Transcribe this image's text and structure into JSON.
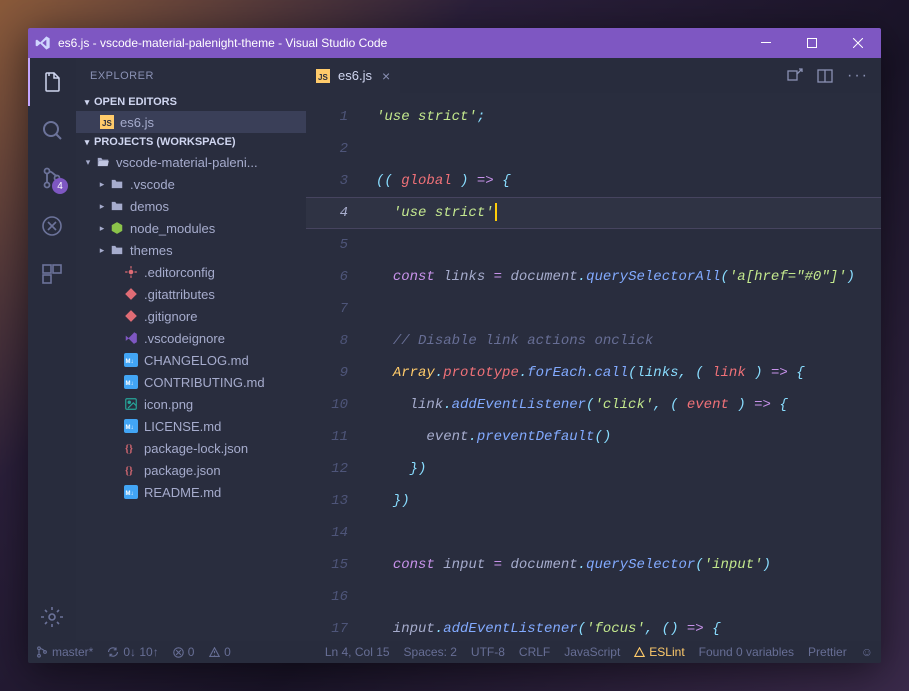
{
  "titlebar": {
    "title": "es6.js - vscode-material-palenight-theme - Visual Studio Code"
  },
  "activity": {
    "scmBadge": "4"
  },
  "sidebar": {
    "title": "EXPLORER",
    "openEditorsLabel": "OPEN EDITORS",
    "workspaceLabel": "PROJECTS (WORKSPACE)",
    "openEditors": [
      {
        "label": "es6.js",
        "icon": "js",
        "selected": true
      }
    ],
    "tree": [
      {
        "depth": 0,
        "chev": "▾",
        "icon": "folder-open",
        "label": "vscode-material-paleni...",
        "color": "#a6accd"
      },
      {
        "depth": 1,
        "chev": "▸",
        "icon": "folder",
        "label": ".vscode",
        "color": "#a6accd"
      },
      {
        "depth": 1,
        "chev": "▸",
        "icon": "folder",
        "label": "demos",
        "color": "#a6accd"
      },
      {
        "depth": 1,
        "chev": "▸",
        "icon": "node",
        "label": "node_modules",
        "color": "#8bc34a"
      },
      {
        "depth": 1,
        "chev": "▸",
        "icon": "folder",
        "label": "themes",
        "color": "#a6accd"
      },
      {
        "depth": 2,
        "chev": "",
        "icon": "config",
        "label": ".editorconfig",
        "color": "#e06c75"
      },
      {
        "depth": 2,
        "chev": "",
        "icon": "git",
        "label": ".gitattributes",
        "color": "#e06c75"
      },
      {
        "depth": 2,
        "chev": "",
        "icon": "git",
        "label": ".gitignore",
        "color": "#e06c75"
      },
      {
        "depth": 2,
        "chev": "",
        "icon": "vscode",
        "label": ".vscodeignore",
        "color": "#7e57c2"
      },
      {
        "depth": 2,
        "chev": "",
        "icon": "md",
        "label": "CHANGELOG.md",
        "color": "#42a5f5"
      },
      {
        "depth": 2,
        "chev": "",
        "icon": "md",
        "label": "CONTRIBUTING.md",
        "color": "#42a5f5"
      },
      {
        "depth": 2,
        "chev": "",
        "icon": "image",
        "label": "icon.png",
        "color": "#26a69a"
      },
      {
        "depth": 2,
        "chev": "",
        "icon": "md",
        "label": "LICENSE.md",
        "color": "#42a5f5"
      },
      {
        "depth": 2,
        "chev": "",
        "icon": "json",
        "label": "package-lock.json",
        "color": "#e06c75"
      },
      {
        "depth": 2,
        "chev": "",
        "icon": "json",
        "label": "package.json",
        "color": "#e06c75"
      },
      {
        "depth": 2,
        "chev": "",
        "icon": "md",
        "label": "README.md",
        "color": "#42a5f5"
      }
    ]
  },
  "editor": {
    "tabs": [
      {
        "label": "es6.js"
      }
    ],
    "cursorLine": 4,
    "code": [
      [
        [
          "str",
          "'use strict'"
        ],
        [
          "punc",
          ";"
        ]
      ],
      [],
      [
        [
          "punc",
          "(( "
        ],
        [
          "var",
          "global"
        ],
        [
          "punc",
          " ) "
        ],
        [
          "kw",
          "=>"
        ],
        [
          "punc",
          " {"
        ]
      ],
      [
        [
          "plain",
          "  "
        ],
        [
          "str",
          "'use strict'"
        ]
      ],
      [],
      [
        [
          "plain",
          "  "
        ],
        [
          "kw",
          "const"
        ],
        [
          "plain",
          " links "
        ],
        [
          "op",
          "="
        ],
        [
          "plain",
          " document"
        ],
        [
          "punc",
          "."
        ],
        [
          "fn",
          "querySelectorAll"
        ],
        [
          "punc",
          "("
        ],
        [
          "str",
          "'a[href=\"#0\"]'"
        ],
        [
          "punc",
          ")"
        ]
      ],
      [],
      [
        [
          "plain",
          "  "
        ],
        [
          "comm",
          "// Disable link actions onclick"
        ]
      ],
      [
        [
          "plain",
          "  "
        ],
        [
          "prop",
          "Array"
        ],
        [
          "punc",
          "."
        ],
        [
          "var",
          "prototype"
        ],
        [
          "punc",
          "."
        ],
        [
          "fn",
          "forEach"
        ],
        [
          "punc",
          "."
        ],
        [
          "fn",
          "call"
        ],
        [
          "punc",
          "(links, ( "
        ],
        [
          "var",
          "link"
        ],
        [
          "punc",
          " ) "
        ],
        [
          "kw",
          "=>"
        ],
        [
          "punc",
          " {"
        ]
      ],
      [
        [
          "plain",
          "    link"
        ],
        [
          "punc",
          "."
        ],
        [
          "fn",
          "addEventListener"
        ],
        [
          "punc",
          "("
        ],
        [
          "str",
          "'click'"
        ],
        [
          "punc",
          ", ( "
        ],
        [
          "var",
          "event"
        ],
        [
          "punc",
          " ) "
        ],
        [
          "kw",
          "=>"
        ],
        [
          "punc",
          " {"
        ]
      ],
      [
        [
          "plain",
          "      event"
        ],
        [
          "punc",
          "."
        ],
        [
          "fn",
          "preventDefault"
        ],
        [
          "punc",
          "()"
        ]
      ],
      [
        [
          "plain",
          "    "
        ],
        [
          "punc",
          "})"
        ]
      ],
      [
        [
          "plain",
          "  "
        ],
        [
          "punc",
          "})"
        ]
      ],
      [],
      [
        [
          "plain",
          "  "
        ],
        [
          "kw",
          "const"
        ],
        [
          "plain",
          " input "
        ],
        [
          "op",
          "="
        ],
        [
          "plain",
          " document"
        ],
        [
          "punc",
          "."
        ],
        [
          "fn",
          "querySelector"
        ],
        [
          "punc",
          "("
        ],
        [
          "str",
          "'input'"
        ],
        [
          "punc",
          ")"
        ]
      ],
      [],
      [
        [
          "plain",
          "  input"
        ],
        [
          "punc",
          "."
        ],
        [
          "fn",
          "addEventListener"
        ],
        [
          "punc",
          "("
        ],
        [
          "str",
          "'focus'"
        ],
        [
          "punc",
          ", () "
        ],
        [
          "kw",
          "=>"
        ],
        [
          "punc",
          " {"
        ]
      ]
    ]
  },
  "status": {
    "branch": "master*",
    "sync": "0↓ 10↑",
    "errors": "0",
    "warnings": "0",
    "position": "Ln 4, Col 15",
    "spaces": "Spaces: 2",
    "encoding": "UTF-8",
    "eol": "CRLF",
    "language": "JavaScript",
    "eslint": "ESLint",
    "foundVars": "Found 0 variables",
    "prettier": "Prettier"
  },
  "iconSvgs": {
    "folder": "<svg width='14' height='14' viewBox='0 0 24 24' fill='#a6accd'><path d='M3 5h6l2 3h10v11H3z'/></svg>",
    "folder-open": "<svg width='14' height='14' viewBox='0 0 24 24' fill='#a6accd'><path d='M3 5h6l2 3h10v2H5l-2 9V5z'/><path d='M5 10h17l-2 9H3z' fill='#c0c5e0'/></svg>",
    "node": "<svg width='14' height='14' viewBox='0 0 24 24' fill='#8bc34a'><path d='M12 2l9 5v10l-9 5-9-5V7z'/></svg>",
    "js": "<svg width='14' height='14'><rect width='14' height='14' fill='#ffcb6b'/><text x='2' y='11' font-size='8' font-family='Arial' font-weight='bold' font-style='normal' fill='#292d3e'>JS</text></svg>",
    "config": "<svg width='14' height='14' viewBox='0 0 24 24' fill='#e06c75'><circle cx='12' cy='12' r='4'/><path d='M12 2v4M12 18v4M2 12h4M18 12h4' stroke='#e06c75' stroke-width='2'/></svg>",
    "git": "<svg width='14' height='14' viewBox='0 0 24 24' fill='#e06c75'><path d='M12 2l10 10-10 10L2 12z'/></svg>",
    "vscode": "<svg width='14' height='14' viewBox='0 0 24 24' fill='#7e57c2'><path d='M17 2l5 3v14l-5 3-9-9-5 4V8l5 4 9-9z'/></svg>",
    "md": "<svg width='14' height='14'><rect width='14' height='14' rx='2' fill='#42a5f5'/><text x='1.5' y='10' font-size='6' font-family='Arial' font-weight='bold' font-style='normal' fill='#fff'>M↓</text></svg>",
    "image": "<svg width='14' height='14' viewBox='0 0 24 24' fill='none' stroke='#26a69a' stroke-width='2'><rect x='3' y='3' width='18' height='18' rx='2'/><circle cx='9' cy='9' r='2' fill='#26a69a'/><path d='M21 15l-5-5-9 9'/></svg>",
    "json": "<svg width='14' height='14'><text x='1' y='11' font-size='10' font-family='Consolas' font-weight='bold' font-style='normal' fill='#e06c75'>{}</text></svg>"
  }
}
